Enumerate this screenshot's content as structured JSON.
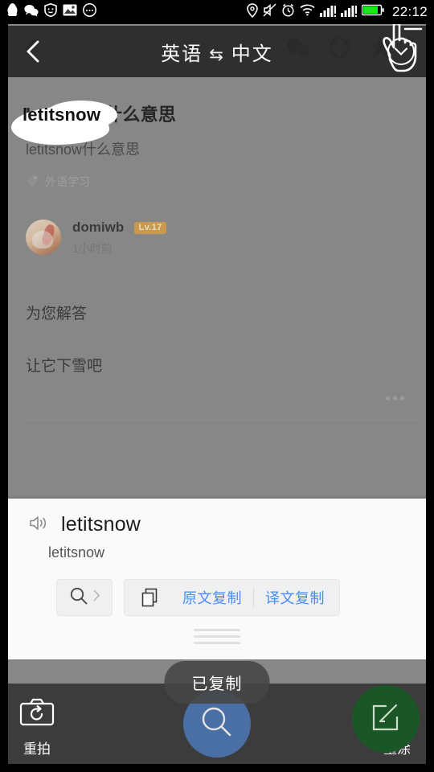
{
  "statusbar": {
    "time": "22:12",
    "left_icons": [
      "qq-penguin-icon",
      "wechat-icon",
      "shield-icon",
      "gallery-icon",
      "chat-icon"
    ],
    "right_icons": [
      "location-icon",
      "mute-icon",
      "alarm-icon",
      "wifi-icon",
      "signal-1-icon",
      "signal-2-icon",
      "battery-icon"
    ]
  },
  "translation_header": {
    "back_icon": "back-chevron-icon",
    "source_lang": "英语",
    "swap_symbol": "⇆",
    "target_lang": "中文",
    "collapse_icon": "chevron-down-icon"
  },
  "background_page": {
    "back_icon": "back-chevron-icon",
    "topbar_icons": [
      "wechat-share-icon",
      "moments-camera-icon",
      "favorite-star-icon",
      "more-vertical-icon"
    ],
    "question_title": "letitsnow什么意思",
    "highlight_text": "letitsnow",
    "question_subtitle": "letitsnow什么意思",
    "tag_icon": "tag-icon",
    "tag_label": "外语学习",
    "answer": {
      "username": "domiwb",
      "level_badge": "Lv.17",
      "time": "1小时前",
      "line1": "为您解答",
      "line2": "让它下雪吧",
      "more_icon": "more-horizontal-icon"
    }
  },
  "translation_card": {
    "speaker_icon": "speaker-icon",
    "source_text": "letitsnow",
    "translated_text": "letitsnow",
    "search_icon": "search-icon",
    "search_chevron_icon": "chevron-right-icon",
    "copy_icon": "copy-icon",
    "copy_source_label": "原文复制",
    "copy_translation_label": "译文复制",
    "drag_handle_icon": "drag-handle-icon",
    "link_color": "#4a8cf7"
  },
  "toast": {
    "message": "已复制"
  },
  "toolbar": {
    "retake": {
      "icon": "camera-retake-icon",
      "label": "重拍"
    },
    "search_fab": {
      "icon": "search-icon",
      "color": "#4a6fa5"
    },
    "repaint": {
      "icon": "edit-square-icon",
      "label": "重涂",
      "color": "#1b5726"
    },
    "cursor": "hand-pointer-cursor"
  }
}
